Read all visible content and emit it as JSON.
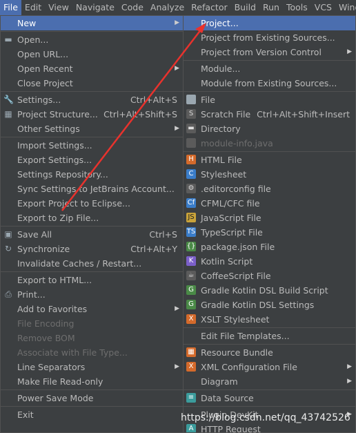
{
  "menubar": [
    "File",
    "Edit",
    "View",
    "Navigate",
    "Code",
    "Analyze",
    "Refactor",
    "Build",
    "Run",
    "Tools",
    "VCS",
    "Wind"
  ],
  "file_menu": [
    {
      "label": "New",
      "arrow": true,
      "selected": true
    },
    {
      "sep": true
    },
    {
      "label": "Open...",
      "icon": "folder-icon"
    },
    {
      "label": "Open URL..."
    },
    {
      "label": "Open Recent",
      "arrow": true
    },
    {
      "label": "Close Project"
    },
    {
      "sep": true
    },
    {
      "label": "Settings...",
      "shortcut": "Ctrl+Alt+S",
      "icon": "wrench-icon"
    },
    {
      "label": "Project Structure...",
      "shortcut": "Ctrl+Alt+Shift+S",
      "icon": "project-structure-icon"
    },
    {
      "label": "Other Settings",
      "arrow": true
    },
    {
      "sep": true
    },
    {
      "label": "Import Settings..."
    },
    {
      "label": "Export Settings..."
    },
    {
      "label": "Settings Repository..."
    },
    {
      "label": "Sync Settings to JetBrains Account..."
    },
    {
      "label": "Export Project to Eclipse..."
    },
    {
      "label": "Export to Zip File..."
    },
    {
      "sep": true
    },
    {
      "label": "Save All",
      "shortcut": "Ctrl+S",
      "icon": "save-icon"
    },
    {
      "label": "Synchronize",
      "shortcut": "Ctrl+Alt+Y",
      "icon": "sync-icon"
    },
    {
      "label": "Invalidate Caches / Restart..."
    },
    {
      "sep": true
    },
    {
      "label": "Export to HTML..."
    },
    {
      "label": "Print...",
      "icon": "print-icon"
    },
    {
      "label": "Add to Favorites",
      "arrow": true
    },
    {
      "label": "File Encoding",
      "disabled": true
    },
    {
      "label": "Remove BOM",
      "disabled": true
    },
    {
      "label": "Associate with File Type...",
      "disabled": true
    },
    {
      "label": "Line Separators",
      "arrow": true
    },
    {
      "label": "Make File Read-only"
    },
    {
      "sep": true
    },
    {
      "label": "Power Save Mode"
    },
    {
      "sep": true
    },
    {
      "label": "Exit"
    }
  ],
  "new_menu": [
    {
      "label": "Project...",
      "selected": true
    },
    {
      "label": "Project from Existing Sources..."
    },
    {
      "label": "Project from Version Control",
      "arrow": true
    },
    {
      "sep": true
    },
    {
      "label": "Module..."
    },
    {
      "label": "Module from Existing Sources..."
    },
    {
      "sep": true
    },
    {
      "label": "File",
      "icon": "file-icon",
      "glyph": "",
      "cls": "i-file"
    },
    {
      "label": "Scratch File",
      "shortcut": "Ctrl+Alt+Shift+Insert",
      "icon": "scratch-file-icon",
      "glyph": "S",
      "cls": "i-dark"
    },
    {
      "label": "Directory",
      "icon": "directory-icon",
      "glyph": "▬",
      "cls": "i-dark"
    },
    {
      "label": "module-info.java",
      "disabled": true,
      "icon": "module-info-icon",
      "glyph": "",
      "cls": "i-dark"
    },
    {
      "sep": true
    },
    {
      "label": "HTML File",
      "icon": "html-file-icon",
      "glyph": "H",
      "cls": "i-orange"
    },
    {
      "label": "Stylesheet",
      "icon": "css-file-icon",
      "glyph": "C",
      "cls": "i-blue"
    },
    {
      "label": ".editorconfig file",
      "icon": "editorconfig-icon",
      "glyph": "⚙",
      "cls": "i-dark"
    },
    {
      "label": "CFML/CFC file",
      "icon": "cfml-file-icon",
      "glyph": "Cf",
      "cls": "i-blue"
    },
    {
      "label": "JavaScript File",
      "icon": "javascript-file-icon",
      "glyph": "JS",
      "cls": "i-yellow"
    },
    {
      "label": "TypeScript File",
      "icon": "typescript-file-icon",
      "glyph": "TS",
      "cls": "i-blue"
    },
    {
      "label": "package.json File",
      "icon": "package-json-icon",
      "glyph": "{}",
      "cls": "i-green"
    },
    {
      "label": "Kotlin Script",
      "icon": "kotlin-script-icon",
      "glyph": "K",
      "cls": "i-purple"
    },
    {
      "label": "CoffeeScript File",
      "icon": "coffeescript-file-icon",
      "glyph": "☕",
      "cls": "i-dark"
    },
    {
      "label": "Gradle Kotlin DSL Build Script",
      "icon": "gradle-icon",
      "glyph": "G",
      "cls": "i-green"
    },
    {
      "label": "Gradle Kotlin DSL Settings",
      "icon": "gradle-settings-icon",
      "glyph": "G",
      "cls": "i-green"
    },
    {
      "label": "XSLT Stylesheet",
      "icon": "xslt-file-icon",
      "glyph": "X",
      "cls": "i-orange"
    },
    {
      "sep": true
    },
    {
      "label": "Edit File Templates..."
    },
    {
      "sep": true
    },
    {
      "label": "Resource Bundle",
      "icon": "resource-bundle-icon",
      "glyph": "▦",
      "cls": "i-orange"
    },
    {
      "label": "XML Configuration File",
      "arrow": true,
      "icon": "xml-config-icon",
      "glyph": "X",
      "cls": "i-orange"
    },
    {
      "label": "Diagram",
      "arrow": true
    },
    {
      "sep": true
    },
    {
      "label": "Data Source",
      "icon": "data-source-icon",
      "glyph": "≡",
      "cls": "i-teal"
    },
    {
      "sep": true
    },
    {
      "label": "Plugin DevKit",
      "arrow": true
    },
    {
      "label": "HTTP Request",
      "icon": "http-request-icon",
      "glyph": "A",
      "cls": "i-teal"
    }
  ],
  "watermark": "https://blog.csdn.net/qq_43742526",
  "colors": {
    "menu_bg": "#3c3f41",
    "selected": "#4b6eaf",
    "arrow_annotation": "#e8322d"
  }
}
